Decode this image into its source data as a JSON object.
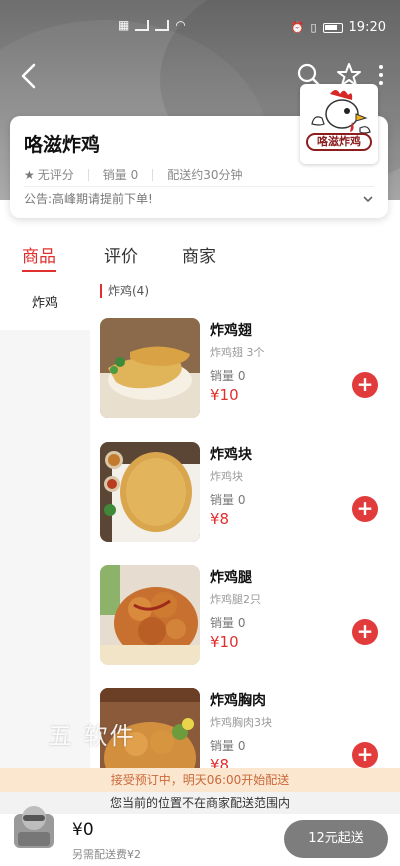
{
  "status_bar": {
    "time": "19:20"
  },
  "shop": {
    "name": "咯滋炸鸡",
    "rating": "无评分",
    "sales": "销量 0",
    "delivery_time": "配送约30分钟",
    "announcement": "公告:高峰期请提前下单!",
    "logo_text": "咯滋炸鸡"
  },
  "tabs": [
    {
      "label": "商品",
      "active": true
    },
    {
      "label": "评价",
      "active": false
    },
    {
      "label": "商家",
      "active": false
    }
  ],
  "categories": [
    {
      "label": "炸鸡",
      "selected": true
    }
  ],
  "section": {
    "title": "炸鸡(4)"
  },
  "dishes": [
    {
      "name": "炸鸡翅",
      "desc": "炸鸡翅 3个",
      "sales": "销量 0",
      "price": "¥10"
    },
    {
      "name": "炸鸡块",
      "desc": "炸鸡块",
      "sales": "销量 0",
      "price": "¥8"
    },
    {
      "name": "炸鸡腿",
      "desc": "炸鸡腿2只",
      "sales": "销量 0",
      "price": "¥10"
    },
    {
      "name": "炸鸡胸肉",
      "desc": "炸鸡胸肉3块",
      "sales": "销量 0",
      "price": "¥8"
    }
  ],
  "watermark": "五 软件",
  "notices": {
    "preorder": "接受预订中，明天06:00开始配送",
    "out_of_range": "您当前的位置不在商家配送范围内"
  },
  "cart": {
    "total": "¥0",
    "delivery_fee": "另需配送费¥2",
    "checkout_label": "12元起送"
  },
  "colors": {
    "accent": "#e0302e",
    "checkout_bg": "#7d7d7d",
    "notice_bg": "#fbe7cf"
  }
}
